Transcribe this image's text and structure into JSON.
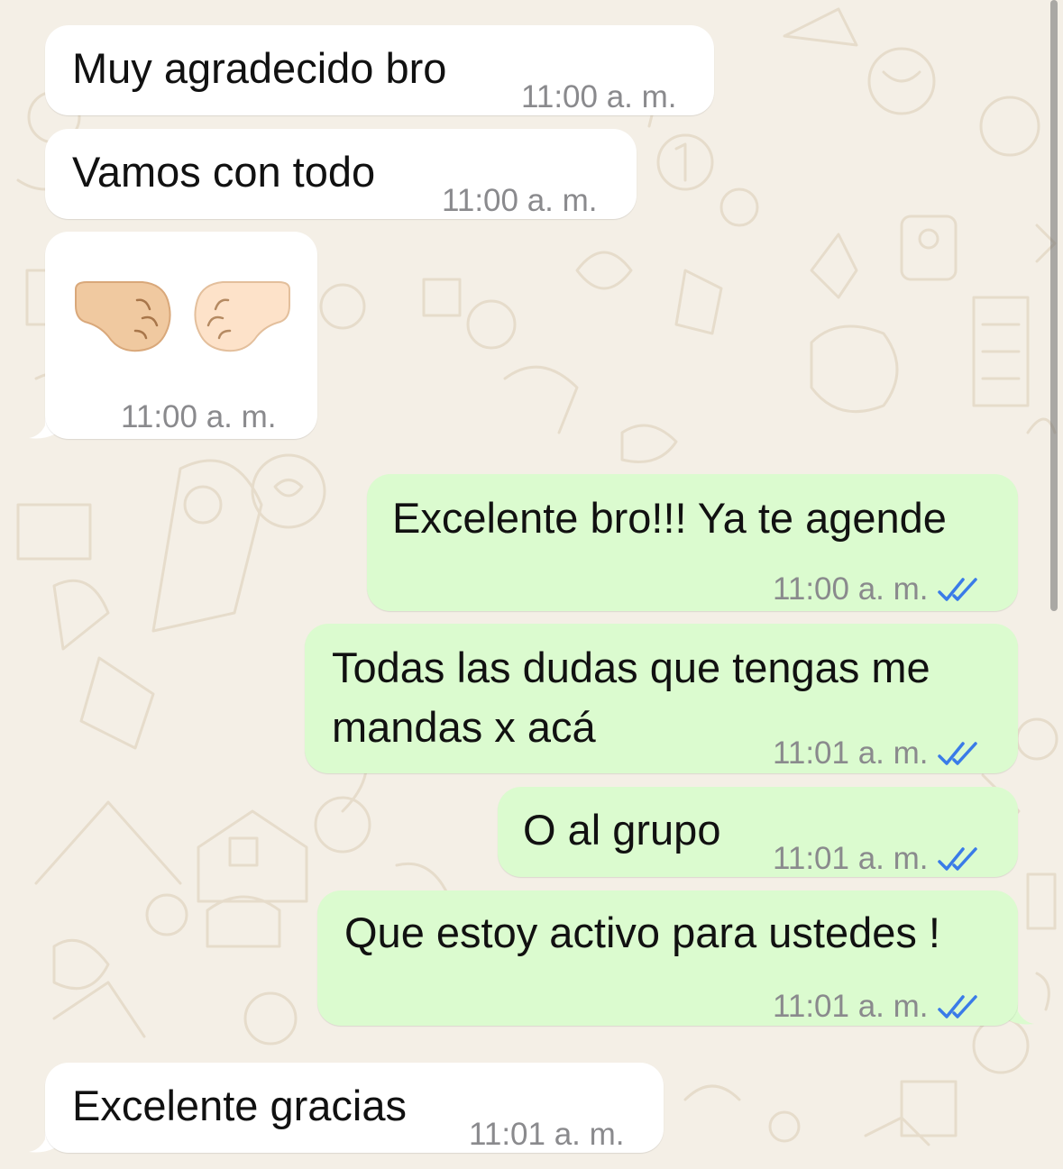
{
  "colors": {
    "background": "#f4efe6",
    "incoming_bubble": "#ffffff",
    "outgoing_bubble": "#dbfbcf",
    "timestamp": "#8a8a8d",
    "read_ticks": "#3a7be8"
  },
  "messages": [
    {
      "direction": "in",
      "text": "Muy agradecido bro",
      "time": "11:00 a. m."
    },
    {
      "direction": "in",
      "text": "Vamos con todo",
      "time": "11:00 a. m."
    },
    {
      "direction": "in",
      "emoji": "fist-bump-emoji",
      "time": "11:00 a. m."
    },
    {
      "direction": "out",
      "text": "Excelente bro!!! Ya te agende",
      "time": "11:00 a. m.",
      "status": "read"
    },
    {
      "direction": "out",
      "text_line1": "Todas las dudas que tengas me",
      "text_line2": "mandas x acá",
      "time": "11:01 a. m.",
      "status": "read"
    },
    {
      "direction": "out",
      "text": "O al grupo",
      "time": "11:01 a. m.",
      "status": "read"
    },
    {
      "direction": "out",
      "text": "Que estoy activo para ustedes !",
      "time": "11:01 a. m.",
      "status": "read"
    },
    {
      "direction": "in",
      "text": "Excelente gracias",
      "time": "11:01 a. m."
    }
  ]
}
